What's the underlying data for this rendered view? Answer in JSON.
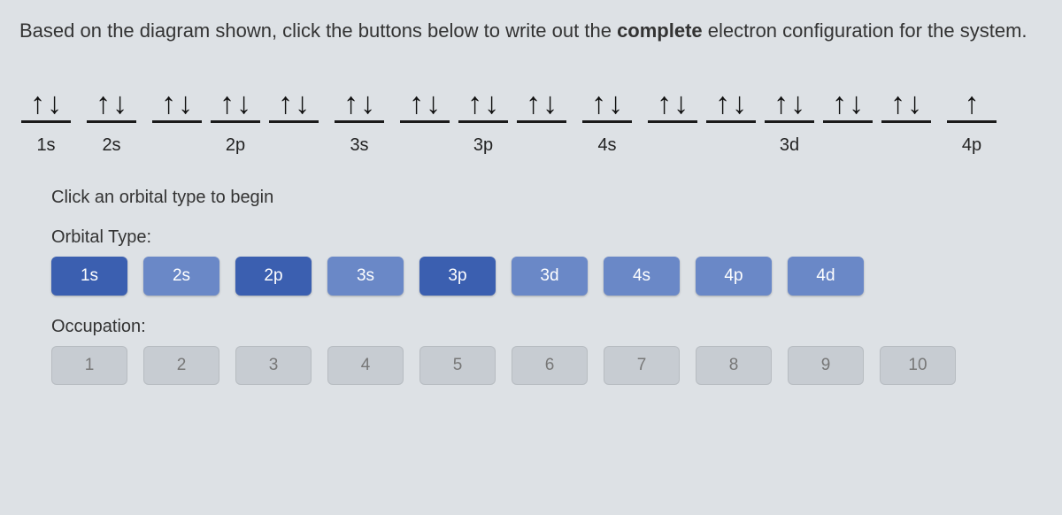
{
  "instruction": {
    "pre": "Based on the diagram shown, click the buttons below to write out the ",
    "bold": "complete",
    "post": " electron configuration for the system."
  },
  "diagram": {
    "subshells": [
      {
        "label": "1s",
        "boxes": [
          [
            "↑",
            "↓"
          ]
        ]
      },
      {
        "label": "2s",
        "boxes": [
          [
            "↑",
            "↓"
          ]
        ]
      },
      {
        "label": "2p",
        "boxes": [
          [
            "↑",
            "↓"
          ],
          [
            "↑",
            "↓"
          ],
          [
            "↑",
            "↓"
          ]
        ]
      },
      {
        "label": "3s",
        "boxes": [
          [
            "↑",
            "↓"
          ]
        ]
      },
      {
        "label": "3p",
        "boxes": [
          [
            "↑",
            "↓"
          ],
          [
            "↑",
            "↓"
          ],
          [
            "↑",
            "↓"
          ]
        ]
      },
      {
        "label": "4s",
        "boxes": [
          [
            "↑",
            "↓"
          ]
        ]
      },
      {
        "label": "3d",
        "boxes": [
          [
            "↑",
            "↓"
          ],
          [
            "↑",
            "↓"
          ],
          [
            "↑",
            "↓"
          ],
          [
            "↑",
            "↓"
          ],
          [
            "↑",
            "↓"
          ]
        ]
      },
      {
        "label": "4p",
        "boxes": [
          [
            "↑",
            ""
          ]
        ]
      }
    ]
  },
  "builder": {
    "hint": "Click an orbital type to begin",
    "orbital_label": "Orbital Type:",
    "occupation_label": "Occupation:",
    "orbital_buttons": [
      {
        "label": "1s",
        "variant": "enabled"
      },
      {
        "label": "2s",
        "variant": "enabled light"
      },
      {
        "label": "2p",
        "variant": "enabled"
      },
      {
        "label": "3s",
        "variant": "enabled light"
      },
      {
        "label": "3p",
        "variant": "enabled"
      },
      {
        "label": "3d",
        "variant": "enabled light"
      },
      {
        "label": "4s",
        "variant": "enabled light"
      },
      {
        "label": "4p",
        "variant": "enabled light"
      },
      {
        "label": "4d",
        "variant": "enabled light"
      }
    ],
    "occupation_buttons": [
      {
        "label": "1"
      },
      {
        "label": "2"
      },
      {
        "label": "3"
      },
      {
        "label": "4"
      },
      {
        "label": "5"
      },
      {
        "label": "6"
      },
      {
        "label": "7"
      },
      {
        "label": "8"
      },
      {
        "label": "9"
      },
      {
        "label": "10"
      }
    ]
  }
}
